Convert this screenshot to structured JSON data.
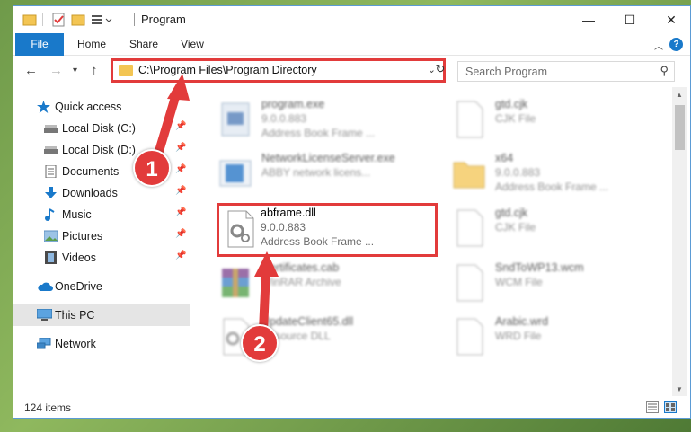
{
  "window": {
    "title": "Program",
    "controls": {
      "minimize": "—",
      "maximize": "☐",
      "close": "✕"
    }
  },
  "ribbon": {
    "tabs": [
      "File",
      "Home",
      "Share",
      "View"
    ]
  },
  "navbar": {
    "address": "C:\\Program Files\\Program Directory",
    "search_placeholder": "Search Program"
  },
  "sidebar": {
    "items": [
      {
        "label": "Quick access",
        "icon": "star-icon",
        "pinned": false
      },
      {
        "label": "Local Disk (C:)",
        "icon": "drive-icon",
        "pinned": true
      },
      {
        "label": "Local Disk (D:)",
        "icon": "drive-icon",
        "pinned": true
      },
      {
        "label": "Documents",
        "icon": "document-icon",
        "pinned": true
      },
      {
        "label": "Downloads",
        "icon": "download-icon",
        "pinned": true
      },
      {
        "label": "Music",
        "icon": "music-icon",
        "pinned": true
      },
      {
        "label": "Pictures",
        "icon": "pictures-icon",
        "pinned": true
      },
      {
        "label": "Videos",
        "icon": "videos-icon",
        "pinned": true
      },
      {
        "label": "OneDrive",
        "icon": "cloud-icon",
        "pinned": false
      },
      {
        "label": "This PC",
        "icon": "computer-icon",
        "pinned": false,
        "selected": true
      },
      {
        "label": "Network",
        "icon": "network-icon",
        "pinned": false
      }
    ]
  },
  "files": {
    "left": [
      {
        "name": "program.exe",
        "meta": "9.0.0.883",
        "meta2": "Address Book Frame ...",
        "icon": "exe-icon"
      },
      {
        "name": "NetworkLicenseServer.exe",
        "meta": "ABBY network licens...",
        "meta2": "",
        "icon": "exe-icon"
      },
      {
        "name": "abframe.dll",
        "meta": "9.0.0.883",
        "meta2": "Address Book Frame ...",
        "icon": "dll-icon",
        "highlighted": true
      },
      {
        "name": "Certificates.cab",
        "meta": "WinRAR Archive",
        "meta2": "",
        "icon": "archive-icon"
      },
      {
        "name": "UpdateClient65.dll",
        "meta": "Resource DLL",
        "meta2": "",
        "icon": "dll-icon"
      }
    ],
    "right": [
      {
        "name": "gtd.cjk",
        "meta": "CJK File",
        "meta2": "",
        "icon": "file-icon"
      },
      {
        "name": "x64",
        "meta": "9.0.0.883",
        "meta2": "Address Book Frame ...",
        "icon": "folder-icon"
      },
      {
        "name": "gtd.cjk",
        "meta": "CJK File",
        "meta2": "",
        "icon": "file-icon"
      },
      {
        "name": "SndToWP13.wcm",
        "meta": "WCM File",
        "meta2": "",
        "icon": "file-icon"
      },
      {
        "name": "Arabic.wrd",
        "meta": "WRD File",
        "meta2": "",
        "icon": "file-icon"
      }
    ]
  },
  "status": {
    "count": "124 items"
  },
  "annotations": {
    "step1": "1",
    "step2": "2"
  },
  "colors": {
    "accent": "#1979ca",
    "highlight": "#e23b3b"
  }
}
